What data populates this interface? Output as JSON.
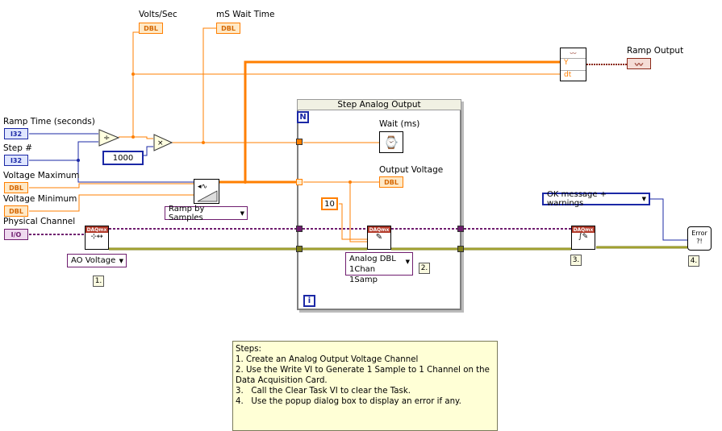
{
  "labels": {
    "volts_sec": "Volts/Sec",
    "ms_wait_time": "mS Wait Time",
    "ramp_output": "Ramp Output",
    "ramp_time": "Ramp Time (seconds)",
    "step_num": "Step #",
    "voltage_maximum": "Voltage Maximum",
    "voltage_minimum": "Voltage Minimum",
    "physical_channel": "Physical Channel",
    "wait_ms": "Wait (ms)",
    "output_voltage": "Output Voltage"
  },
  "terminals": {
    "i32": "I32",
    "dbl": "DBL",
    "io": "I/O"
  },
  "constants": {
    "thousand": "1000",
    "ten": "10"
  },
  "rings": {
    "ramp_mode": "Ramp by Samples",
    "ao_voltage": "AO Voltage",
    "analog_dbl_line1": "Analog DBL",
    "analog_dbl_line2": "1Chan 1Samp",
    "error_mode": "OK message + warnings"
  },
  "loop": {
    "title": "Step Analog Output",
    "count_label": "N",
    "iteration_label": "i"
  },
  "step_numbers": {
    "s1": "1.",
    "s2": "2.",
    "s3": "3.",
    "s4": "4."
  },
  "vi": {
    "daqmx": "DAQmx",
    "error": "Error"
  },
  "notes": {
    "heading": "Steps:",
    "lines": [
      "1. Create an Analog Output Voltage Channel",
      "2. Use the Write VI to Generate 1 Sample to 1 Channel on the Data Acquisition Card.",
      "3.   Call the Clear Task VI to clear the Task.",
      "4.   Use the popup dialog box to display an error if any."
    ]
  },
  "colors": {
    "dbl_wire": "#ff7f00",
    "int_wire": "#1b28a6",
    "task_wire": "#6f1d6f",
    "error_wire": "#7c7c1c"
  }
}
